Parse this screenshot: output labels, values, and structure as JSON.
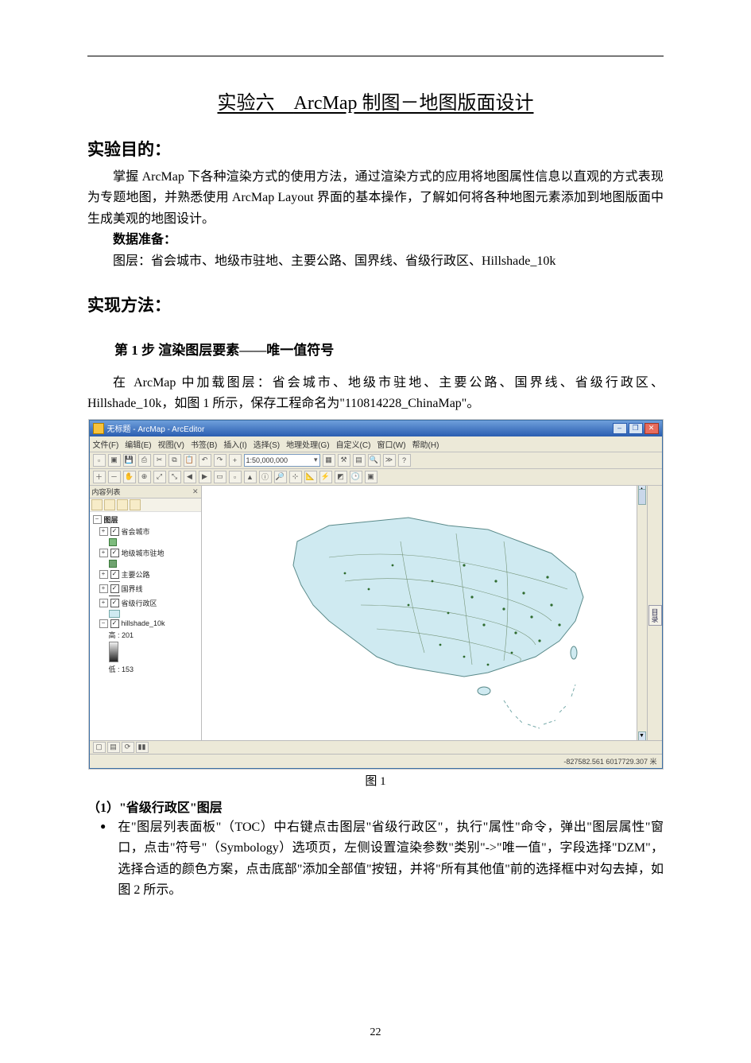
{
  "title_prefix": "实验六　",
  "title_main": "ArcMap 制图－地图版面设计",
  "sections": {
    "objective_heading": "实验目的：",
    "objective_p": "掌握 ArcMap 下各种渲染方式的使用方法，通过渲染方式的应用将地图属性信息以直观的方式表现为专题地图，并熟悉使用 ArcMap Layout 界面的基本操作，了解如何将各种地图元素添加到地图版面中生成美观的地图设计。",
    "data_prep_label": "数据准备：",
    "data_prep_body": "图层：省会城市、地级市驻地、主要公路、国界线、省级行政区、Hillshade_10k",
    "method_heading": "实现方法：",
    "step1_heading": "第 1 步  渲染图层要素——唯一值符号",
    "step1_p": "在 ArcMap 中加载图层：省会城市、地级市驻地、主要公路、国界线、省级行政区、Hillshade_10k，如图 1 所示，保存工程命名为\"110814228_ChinaMap\"。",
    "fig1_caption": "图 1",
    "sub_heading_1": "（1）\"省级行政区\"图层",
    "bullet_1": "在\"图层列表面板\"（TOC）中右键点击图层\"省级行政区\"，执行\"属性\"命令，弹出\"图层属性\"窗口，点击\"符号\"（Symbology）选项页，左侧设置渲染参数\"类别\"->\"唯一值\"，字段选择\"DZM\"，选择合适的颜色方案，点击底部\"添加全部值\"按钮，并将\"所有其他值\"前的选择框中对勾去掉，如图 2 所示。"
  },
  "page_number": "22",
  "arcmap": {
    "title": "无标题 - ArcMap - ArcEditor",
    "menus": [
      "文件(F)",
      "编辑(E)",
      "视图(V)",
      "书签(B)",
      "插入(I)",
      "选择(S)",
      "地理处理(G)",
      "自定义(C)",
      "窗口(W)",
      "帮助(H)"
    ],
    "scale": "1:50,000,000",
    "toc_title": "内容列表",
    "dataframe": "图层",
    "layers": [
      {
        "name": "省会城市",
        "checked": true
      },
      {
        "name": "地级城市驻地",
        "checked": true
      },
      {
        "name": "主要公路",
        "checked": true
      },
      {
        "name": "国界线",
        "checked": true
      },
      {
        "name": "省级行政区",
        "checked": true
      },
      {
        "name": "hillshade_10k",
        "checked": true
      }
    ],
    "hillshade_high_label": "高 : 201",
    "hillshade_low_label": "低 : 153",
    "right_tab": "目录",
    "coords": "-827582.561  6017729.307 米"
  }
}
